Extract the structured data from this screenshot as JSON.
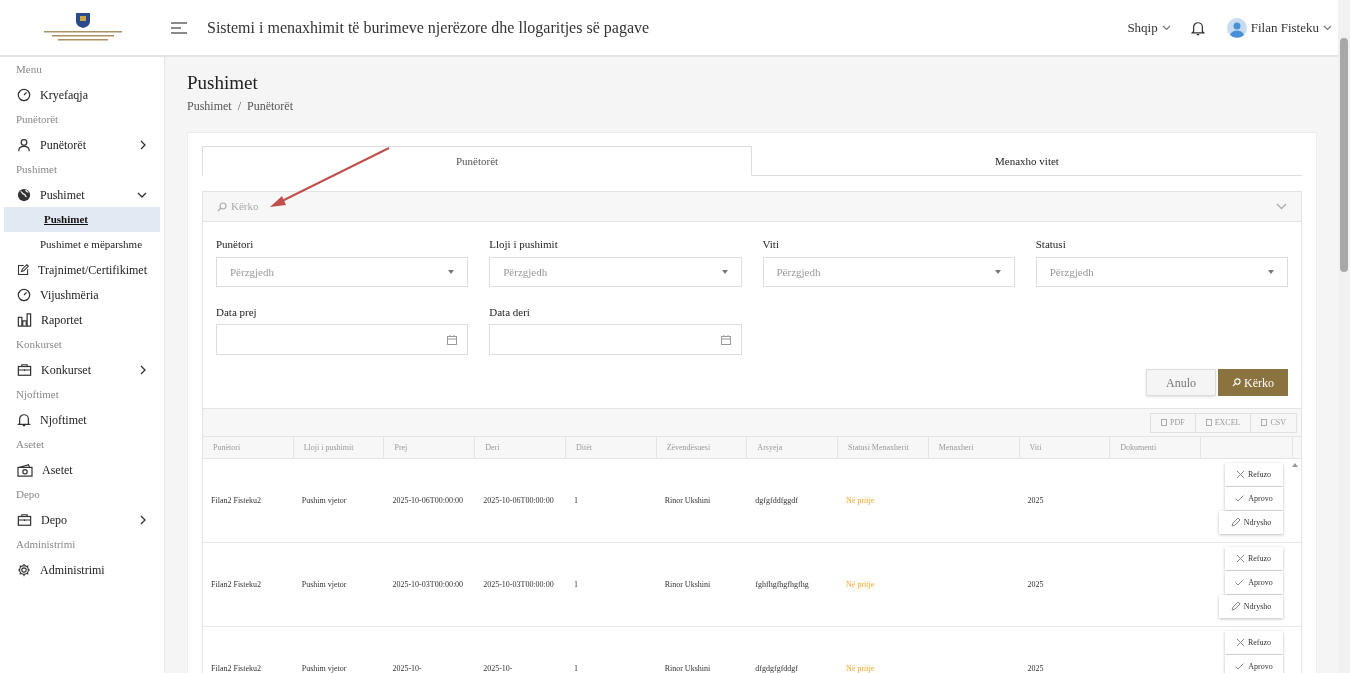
{
  "header": {
    "title": "Sistemi i menaxhimit të burimeve njerëzore dhe llogaritjes së pagave",
    "language": "Shqip",
    "user": "Filan Fisteku"
  },
  "sidebar": [
    {
      "kind": "section",
      "label": "Menu"
    },
    {
      "kind": "item",
      "label": "Kryefaqja"
    },
    {
      "kind": "section",
      "label": "Punëtorët"
    },
    {
      "kind": "item",
      "label": "Punëtorët",
      "expanded": false
    },
    {
      "kind": "section",
      "label": "Pushimet"
    },
    {
      "kind": "item",
      "label": "Pushimet",
      "expanded": true
    },
    {
      "kind": "subitem",
      "label": "Pushimet",
      "selected": true
    },
    {
      "kind": "subitem",
      "label": "Pushimet e mëparshme",
      "selected": false
    },
    {
      "kind": "item",
      "label": "Trajnimet/Certifikimet"
    },
    {
      "kind": "item",
      "label": "Vijushmëria"
    },
    {
      "kind": "item",
      "label": "Raportet"
    },
    {
      "kind": "section",
      "label": "Konkurset"
    },
    {
      "kind": "item",
      "label": "Konkurset",
      "expanded": false
    },
    {
      "kind": "section",
      "label": "Njoftimet"
    },
    {
      "kind": "item",
      "label": "Njoftimet"
    },
    {
      "kind": "section",
      "label": "Asetet"
    },
    {
      "kind": "item",
      "label": "Asetet"
    },
    {
      "kind": "section",
      "label": "Depo"
    },
    {
      "kind": "item",
      "label": "Depo",
      "expanded": false
    },
    {
      "kind": "section",
      "label": "Administrimi"
    },
    {
      "kind": "item",
      "label": "Administrimi"
    }
  ],
  "page": {
    "title": "Pushimet",
    "breadcrumb": {
      "items": [
        "Pushimet",
        "Punëtorët"
      ],
      "separator": "/"
    }
  },
  "tabs": [
    {
      "label": "Punëtorët",
      "selected": true
    },
    {
      "label": "Menaxho vitet",
      "selected": false
    }
  ],
  "filter": {
    "title": "Kërko",
    "expanded": true,
    "selects": [
      {
        "label": "Punëtori",
        "placeholder": "Përzgjedh"
      },
      {
        "label": "Lloji i pushimit",
        "placeholder": "Përzgjedh"
      },
      {
        "label": "Viti",
        "placeholder": "Përzgjedh"
      },
      {
        "label": "Statusi",
        "placeholder": "Përzgjedh"
      }
    ],
    "dates": [
      {
        "label": "Data prej"
      },
      {
        "label": "Data deri"
      }
    ],
    "buttons": {
      "cancel": "Anulo",
      "search": "Kërko"
    }
  },
  "exports": [
    "PDF",
    "EXCEL",
    "CSV"
  ],
  "table": {
    "columns": [
      "Punëtori",
      "Lloji i pushimit",
      "Prej",
      "Deri",
      "Ditët",
      "Zëvendësuesi",
      "Arsyeja",
      "Statusi Menaxherit",
      "Menaxheri",
      "Viti",
      "Dokumenti"
    ],
    "rows": [
      {
        "cells": [
          "Filan2 Fisteku2",
          "Pushim vjetor",
          "2025-10-06T00:00:00",
          "2025-10-06T00:00:00",
          "1",
          "Rinor Ukshini",
          "dgfgfddfggdf",
          "Në pritje",
          "",
          "2025",
          ""
        ],
        "actions": [
          "Refuzo",
          "Aprovo",
          "Ndrysho"
        ]
      },
      {
        "cells": [
          "Filan2 Fisteku2",
          "Pushim vjetor",
          "2025-10-03T00:00:00",
          "2025-10-03T00:00:00",
          "1",
          "Rinor Ukshini",
          "fghfhgfhgfhgfhg",
          "Në pritje",
          "",
          "2025",
          ""
        ],
        "actions": [
          "Refuzo",
          "Aprovo",
          "Ndrysho"
        ]
      },
      {
        "cells": [
          "Filan2 Fisteku2",
          "Pushim vjetor",
          "2025-10-",
          "2025-10-",
          "1",
          "Rinor Ukshini",
          "dfgdgfgfddgf",
          "Në pritje",
          "",
          "2025",
          ""
        ],
        "actions": [
          "Refuzo",
          "Aprovo"
        ]
      }
    ]
  }
}
